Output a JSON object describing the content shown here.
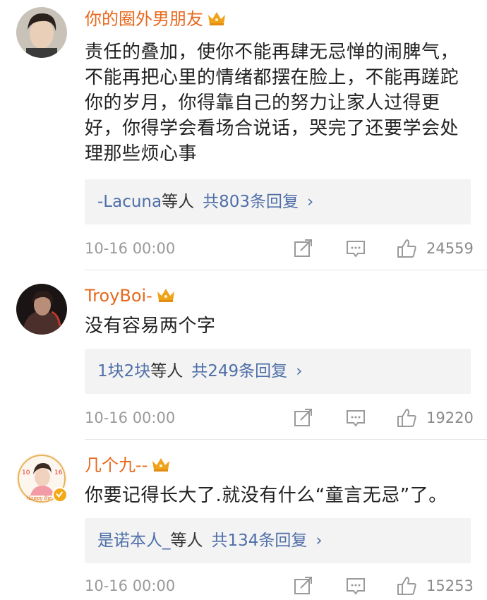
{
  "comments": [
    {
      "username": "你的圈外男朋友",
      "text": "责任的叠加，使你不能再肆无忌惮的闹脾气，不能再把心里的情绪都摆在脸上，不能再蹉跎你的岁月，你得靠自己的努力让家人过得更好，你得学会看场合说话，哭完了还要学会处理那些烦心事",
      "reply_users": "-Lacuna",
      "reply_suffix": "等人",
      "reply_count": "共803条回复",
      "time": "10-16 00:00",
      "likes": "24559"
    },
    {
      "username": "TroyBoi-",
      "text": "没有容易两个字",
      "reply_users": "1块2块",
      "reply_suffix": "等人",
      "reply_count": "共249条回复",
      "time": "10-16 00:00",
      "likes": "19220"
    },
    {
      "username": "几个九--",
      "text": "你要记得长大了.就没有什么“童言无忌”了。",
      "reply_users": "是诺本人_",
      "reply_suffix": "等人",
      "reply_count": "共134条回复",
      "time": "10-16 00:00",
      "likes": "15253"
    }
  ],
  "avatar3_text": "Happy Bir",
  "chevron": "›",
  "colors": {
    "username": "#e8681d",
    "link": "#4f6fa8",
    "meta": "#9a9a9a",
    "reply_bg": "#f3f3f3",
    "crown": "#f0a21b"
  },
  "icons": [
    "crown-vip-icon",
    "share-icon",
    "comment-icon",
    "like-icon",
    "verified-badge-icon"
  ]
}
